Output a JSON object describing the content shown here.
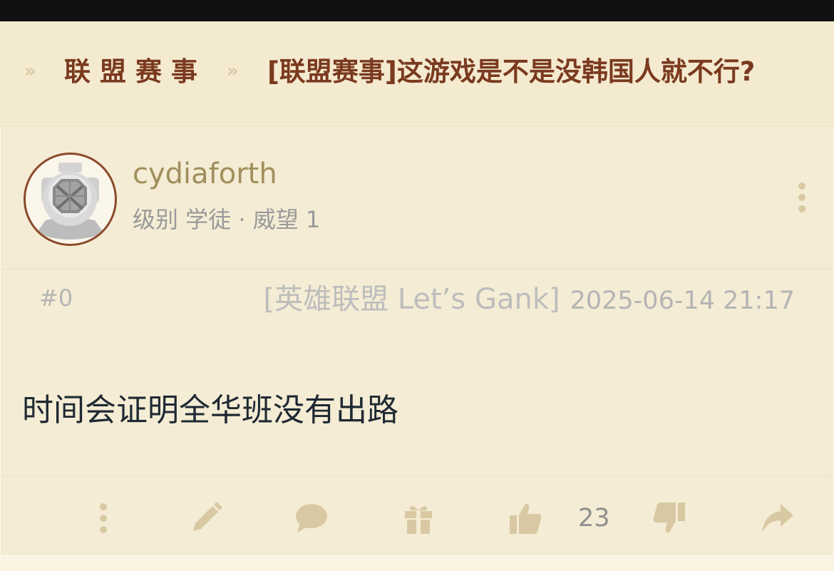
{
  "breadcrumb": {
    "forum": "联盟赛事",
    "thread_title": "[联盟赛事]这游戏是不是没韩国人就不行?",
    "separator": "»"
  },
  "post": {
    "username": "cydiaforth",
    "user_info": "级别 学徒 · 威望 1",
    "floor": "#0",
    "tag": "[英雄联盟 Let’s Gank]",
    "datetime": "2025-06-14 21:17",
    "content": "时间会证明全华班没有出路",
    "like_count": "23"
  },
  "icons": {
    "avatar": "diving-helmet-avatar",
    "menu": "more-vertical-icon",
    "actions": [
      "more-vertical-icon",
      "pencil-icon",
      "comment-icon",
      "gift-icon",
      "thumbs-up-icon",
      "thumbs-down-icon",
      "share-icon"
    ]
  },
  "colors": {
    "breadcrumb_text": "#7a3a1f",
    "icon_tan": "#d8c9a3",
    "background": "#f4ecd4",
    "top_bar": "#111111"
  }
}
